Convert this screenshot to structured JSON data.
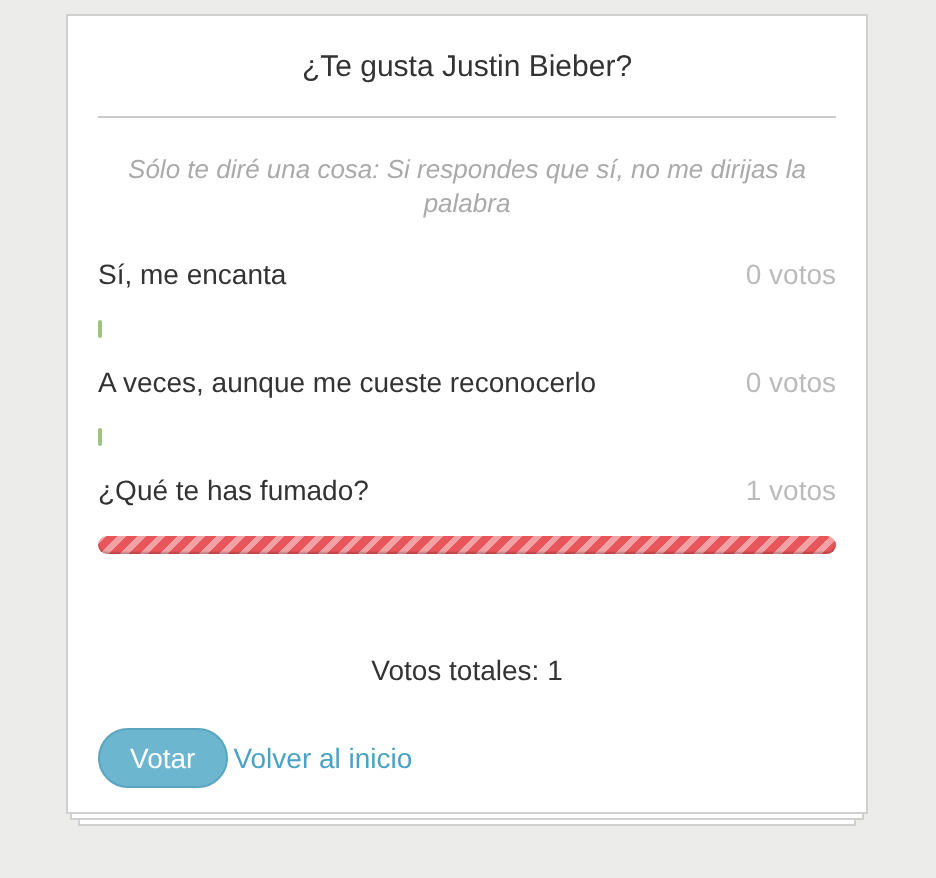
{
  "poll": {
    "title": "¿Te gusta Justin Bieber?",
    "subtitle": "Sólo te diré una cosa: Si respondes que sí, no me dirijas la palabra",
    "options": [
      {
        "label": "Sí, me encanta",
        "votes": "0 votos",
        "kind": "empty",
        "color": "#9cc47a"
      },
      {
        "label": "A veces, aunque me cueste reconocerlo",
        "votes": "0 votos",
        "kind": "empty",
        "color": "#9cc47a"
      },
      {
        "label": "¿Qué te has fumado?",
        "votes": "1 votos",
        "kind": "full",
        "color": "#e8555a"
      }
    ],
    "total": "Votos totales: 1",
    "vote_button": "Votar",
    "back_link": "Volver al inicio"
  }
}
